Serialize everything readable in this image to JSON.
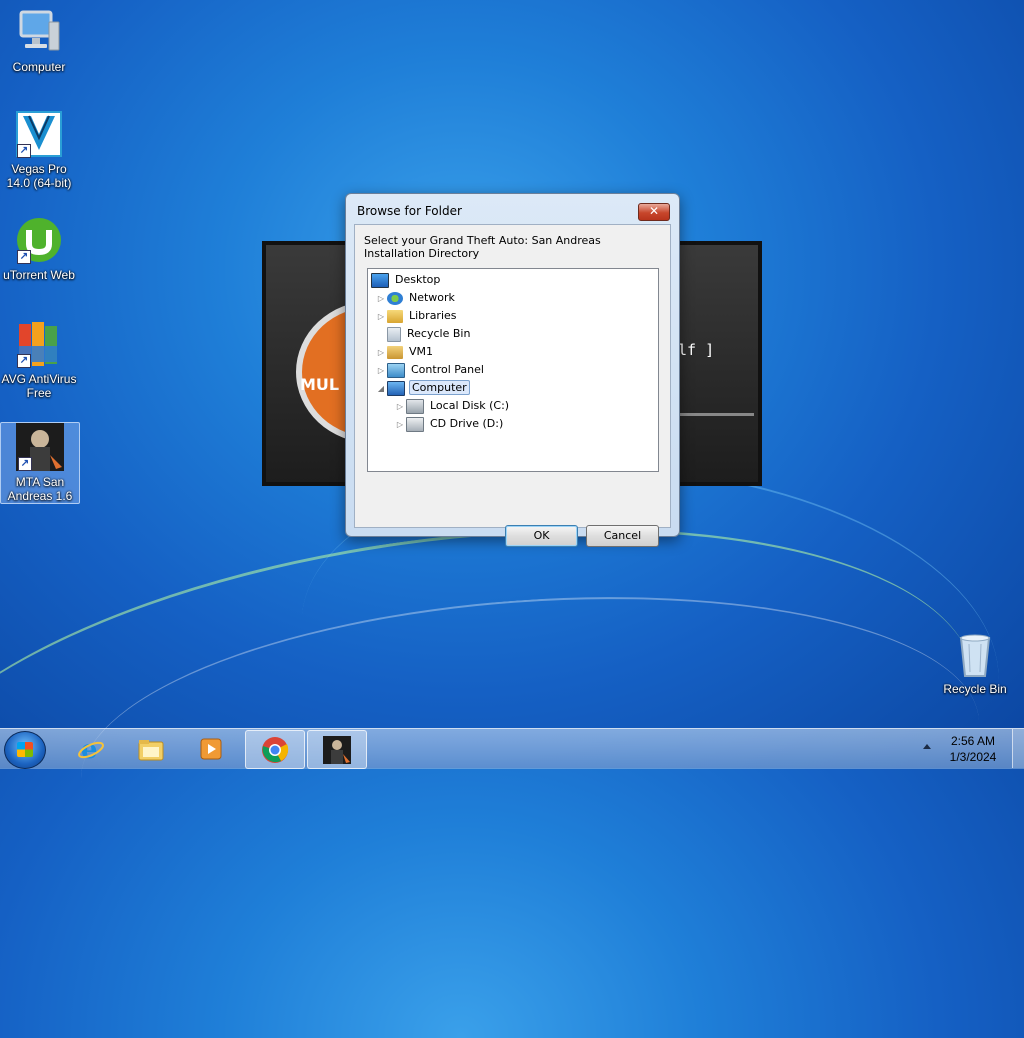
{
  "desktop": {
    "icons": [
      {
        "label": "Computer",
        "icon": "computer-icon"
      },
      {
        "label": "Vegas Pro 14.0 (64-bit)",
        "icon": "vegas-pro-icon"
      },
      {
        "label": "uTorrent Web",
        "icon": "utorrent-icon"
      },
      {
        "label": "AVG AntiVirus Free",
        "icon": "avg-icon"
      },
      {
        "label": "MTA San Andreas 1.6",
        "icon": "mta-icon"
      },
      {
        "label": "Recycle Bin",
        "icon": "recycle-bin-icon"
      }
    ]
  },
  "splash": {
    "logo_text": "MUL",
    "right_text": "lf ]"
  },
  "dialog": {
    "title": "Browse for Folder",
    "close_glyph": "✕",
    "prompt": "Select your Grand Theft Auto: San Andreas Installation Directory",
    "tree": [
      {
        "label": "Desktop",
        "icon": "desktop-icon"
      },
      {
        "label": "Network",
        "icon": "network-icon"
      },
      {
        "label": "Libraries",
        "icon": "libraries-icon"
      },
      {
        "label": "Recycle Bin",
        "icon": "recycle-bin-icon"
      },
      {
        "label": "VM1",
        "icon": "user-folder-icon"
      },
      {
        "label": "Control Panel",
        "icon": "control-panel-icon"
      },
      {
        "label": "Computer",
        "icon": "computer-icon",
        "selected": true
      },
      {
        "label": "Local Disk (C:)",
        "icon": "local-disk-icon"
      },
      {
        "label": "CD Drive (D:)",
        "icon": "cd-drive-icon"
      }
    ],
    "ok_label": "OK",
    "cancel_label": "Cancel"
  },
  "taskbar": {
    "items": [
      "start-button",
      "internet-explorer",
      "windows-explorer",
      "media-player",
      "google-chrome",
      "mta-san-andreas"
    ],
    "time": "2:56 AM",
    "date": "1/3/2024"
  }
}
